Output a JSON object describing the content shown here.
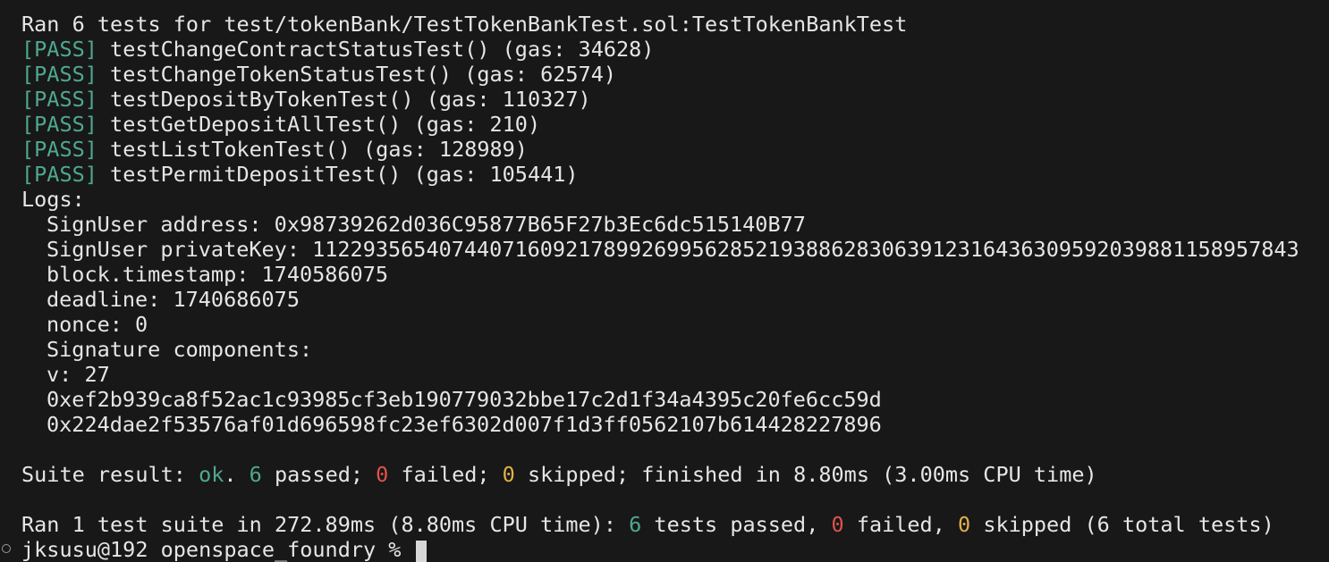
{
  "header_line": "Ran 6 tests for test/tokenBank/TestTokenBankTest.sol:TestTokenBankTest",
  "pass_tag": "[PASS]",
  "tests": [
    {
      "name": "testChangeContractStatusTest()",
      "gas": "(gas: 34628)"
    },
    {
      "name": "testChangeTokenStatusTest()",
      "gas": "(gas: 62574)"
    },
    {
      "name": "testDepositByTokenTest()",
      "gas": "(gas: 110327)"
    },
    {
      "name": "testGetDepositAllTest()",
      "gas": "(gas: 210)"
    },
    {
      "name": "testListTokenTest()",
      "gas": "(gas: 128989)"
    },
    {
      "name": "testPermitDepositTest()",
      "gas": "(gas: 105441)"
    }
  ],
  "logs_label": "Logs:",
  "logs": [
    "SignUser address: 0x98739262d036C95877B65F27b3Ec6dc515140B77",
    "SignUser privateKey: 112293565407440716092178992699562852193886283063912316436309592039881158957843",
    "block.timestamp: 1740586075",
    "deadline: 1740686075",
    "nonce: 0",
    "Signature components:",
    "v: 27",
    "0xef2b939ca8f52ac1c93985cf3eb190779032bbe17c2d1f34a4395c20fe6cc59d",
    "0x224dae2f53576af01d696598fc23ef6302d007f1d3ff0562107b614428227896"
  ],
  "suite_result": {
    "prefix": "Suite result: ",
    "status": "ok",
    "dot": ". ",
    "passed_count": "6",
    "passed_text": " passed; ",
    "failed_count": "0",
    "failed_text": " failed; ",
    "skipped_count": "0",
    "skipped_text": " skipped; finished in 8.80ms (3.00ms CPU time)"
  },
  "summary": {
    "prefix": "Ran 1 test suite in 272.89ms (8.80ms CPU time): ",
    "passed_count": "6",
    "passed_text": " tests passed, ",
    "failed_count": "0",
    "failed_text": " failed, ",
    "skipped_count": "0",
    "skipped_text": " skipped (6 total tests)"
  },
  "prompt": "jksusu@192 openspace_foundry % ",
  "colors": {
    "background": "#181818",
    "text": "#e6e6e6",
    "pass": "#4fa890",
    "failed": "#e0524d",
    "skipped": "#e0b04a"
  }
}
